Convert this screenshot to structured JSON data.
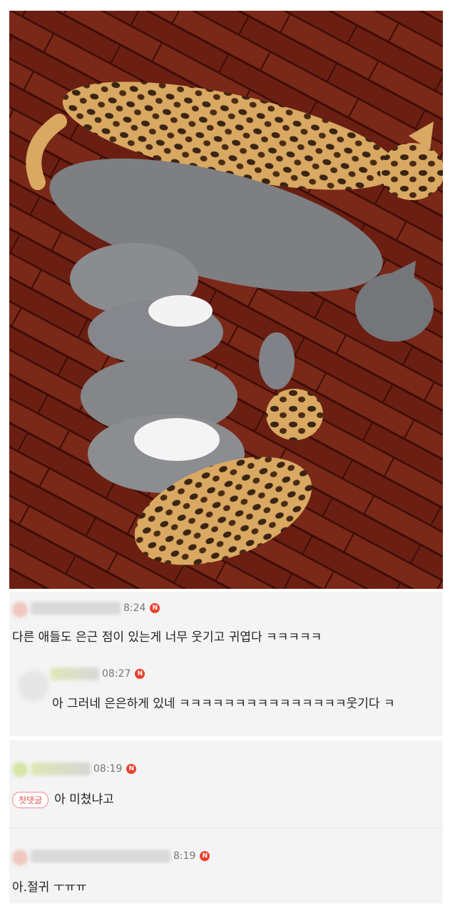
{
  "photo": {
    "alt_subject": "cats-sleeping-on-wood-floor",
    "colors": {
      "floor": "#6b1f12",
      "floor_light": "#8a3524",
      "gray_cat": "#7d7f83",
      "tabby": "#d4a35e"
    }
  },
  "comments": [
    {
      "time": "8:24",
      "badge": "N",
      "text": "다른 애들도 은근 점이 있는게 너무 웃기고 귀엽다 ㅋㅋㅋㅋㅋ",
      "reply": {
        "time": "08:27",
        "badge": "N",
        "text": "아 그러네 은은하게 있네 ㅋㅋㅋㅋㅋㅋㅋㅋㅋㅋㅋㅋㅋㅋㅋ웃기다 ㅋ"
      }
    },
    {
      "time": "08:19",
      "badge": "N",
      "tag": "첫댓글",
      "text": "아 미쳤냐고"
    },
    {
      "time": "8:19",
      "badge": "N",
      "text": "아.절귀 ㅜㅠㅠ"
    }
  ],
  "colors": {
    "badge": "#e8402e",
    "comment_bg": "#f4f4f4",
    "tag": "#e35353"
  }
}
